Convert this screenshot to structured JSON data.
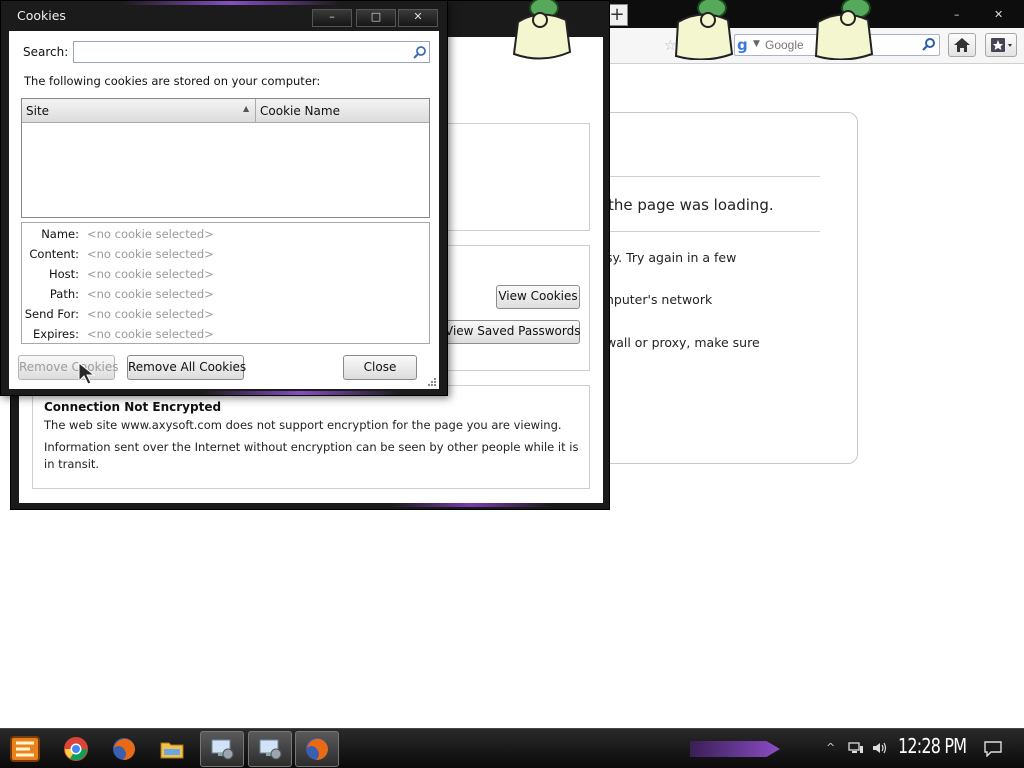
{
  "cookies_dialog": {
    "title": "Cookies",
    "search_label": "Search:",
    "search_value": "",
    "stored_label": "The following cookies are stored on your computer:",
    "columns": [
      "Site",
      "Cookie Name"
    ],
    "details": [
      {
        "label": "Name:",
        "value": "<no cookie selected>"
      },
      {
        "label": "Content:",
        "value": "<no cookie selected>"
      },
      {
        "label": "Host:",
        "value": "<no cookie selected>"
      },
      {
        "label": "Path:",
        "value": "<no cookie selected>"
      },
      {
        "label": "Send For:",
        "value": "<no cookie selected>"
      },
      {
        "label": "Expires:",
        "value": "<no cookie selected>"
      }
    ],
    "buttons": {
      "remove": "Remove Cookies",
      "remove_all": "Remove All Cookies",
      "close": "Close"
    },
    "caption_buttons": {
      "minimize": "–",
      "maximize": "□",
      "close": "✕"
    }
  },
  "page_info": {
    "view_cookies": "View Cookies",
    "view_passwords": "View Saved Passwords",
    "connection_title": "Connection Not Encrypted",
    "connection_line1": "The web site www.axysoft.com does not support encryption for the page you are viewing.",
    "connection_line2": "Information sent over the Internet without encryption can be seen by other people while it is in transit."
  },
  "browser": {
    "new_tab": "+",
    "search_placeholder": "Google",
    "error_title": "the page was loading.",
    "error_lines": [
      "sy. Try again in a few",
      "nputer's network",
      "wall or proxy, make sure"
    ]
  },
  "taskbar": {
    "clock": "12:28 PM",
    "items": [
      "start-icon",
      "chrome-icon",
      "firefox-icon",
      "file-explorer-icon",
      "network-settings-icon",
      "network-settings-icon",
      "firefox-icon"
    ]
  },
  "colors": {
    "accent_purple": "#8a4cc4",
    "window_frame": "#1b1b1b",
    "disabled_text": "#9c9c9c"
  }
}
